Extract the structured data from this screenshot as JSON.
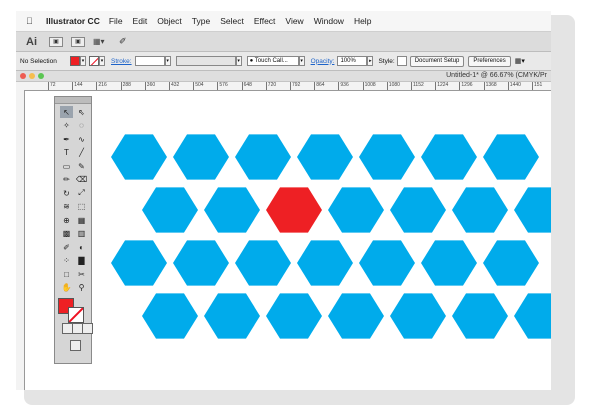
{
  "menubar": {
    "app_name": "Illustrator CC",
    "items": [
      "File",
      "Edit",
      "Object",
      "Type",
      "Select",
      "Effect",
      "View",
      "Window",
      "Help"
    ]
  },
  "appbar": {
    "logo": "Ai"
  },
  "control": {
    "selection": "No Selection",
    "stroke_label": "Stroke:",
    "brush": "Touch Call...",
    "opacity_label": "Opacity:",
    "opacity_value": "100%",
    "style_label": "Style:",
    "document_setup": "Document Setup",
    "preferences": "Preferences"
  },
  "document": {
    "title": "Untitled-1* @ 66.67% (CMYK/Pr",
    "ruler_ticks": [
      "72",
      "144",
      "216",
      "288",
      "360",
      "432",
      "504",
      "576",
      "648",
      "720",
      "792",
      "864",
      "936",
      "1008",
      "1080",
      "1152",
      "1224",
      "1296",
      "1368",
      "1440",
      "151"
    ]
  },
  "colors": {
    "hexagon": "#00abeb",
    "hexagon_selected": "#ee2024",
    "fill": "#ee2024"
  },
  "artwork": {
    "rows": [
      {
        "count": 7,
        "offset": false
      },
      {
        "count": 7,
        "offset": true,
        "highlight_index": 2
      },
      {
        "count": 7,
        "offset": false
      },
      {
        "count": 7,
        "offset": true
      }
    ]
  },
  "tools": [
    "selection-tool",
    "direct-selection-tool",
    "magic-wand-tool",
    "lasso-tool",
    "pen-tool",
    "curvature-tool",
    "type-tool",
    "line-tool",
    "rectangle-tool",
    "paintbrush-tool",
    "pencil-tool",
    "eraser-tool",
    "rotate-tool",
    "scale-tool",
    "width-tool",
    "free-transform-tool",
    "shape-builder-tool",
    "perspective-tool",
    "mesh-tool",
    "gradient-tool",
    "eyedropper-tool",
    "blend-tool",
    "symbol-sprayer-tool",
    "column-graph-tool",
    "artboard-tool",
    "slice-tool",
    "hand-tool",
    "zoom-tool"
  ]
}
